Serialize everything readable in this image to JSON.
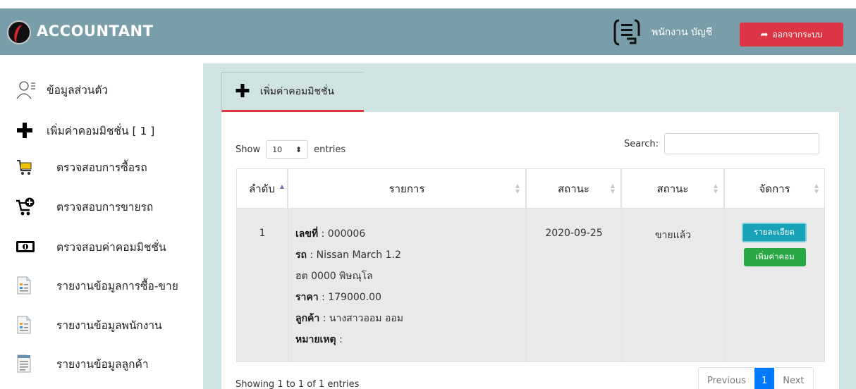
{
  "header": {
    "brand": "ACCOUNTANT",
    "user_label": "พนักงาน บัญชี",
    "logout_label": "ออกจากระบบ",
    "logout_icon": "sign-out-icon",
    "colors": {
      "navbar": "#7a9ea9",
      "logout": "#dc3545"
    }
  },
  "sidebar": {
    "items": [
      {
        "label": "ข้อมูลส่วนตัว",
        "icon": "user-profile-icon"
      },
      {
        "label": "เพิ่มค่าคอมมิชชั่น [ 1 ]",
        "icon": "plus-icon"
      },
      {
        "label": "ตรวจสอบการซื้อรถ",
        "icon": "cart-icon"
      },
      {
        "label": "ตรวจสอบการขายรถ",
        "icon": "cart-add-icon"
      },
      {
        "label": "ตรวจสอบค่าคอมมิชชั่น",
        "icon": "money-icon"
      },
      {
        "label": "รายงานข้อมูลการซื้อ-ขาย",
        "icon": "report-icon"
      },
      {
        "label": "รายงานข้อมูลพนักงาน",
        "icon": "report-icon"
      },
      {
        "label": "รายงานข้อมูลลูกค้า",
        "icon": "document-icon"
      }
    ]
  },
  "tab": {
    "label": "เพิ่มค่าคอมมิชชั่น"
  },
  "table_controls": {
    "show_label": "Show",
    "entries_value": "10",
    "entries_label": "entries",
    "search_label": "Search:"
  },
  "table": {
    "columns": [
      "ลำดับ",
      "รายการ",
      "สถานะ",
      "สถานะ",
      "จัดการ"
    ],
    "rows": [
      {
        "index": "1",
        "details": [
          {
            "key": "เลขที่",
            "value": " : 000006"
          },
          {
            "key": "รถ",
            "value": " : Nissan March 1.2"
          },
          {
            "key": "",
            "value": "ฮต 0000 พิษณุโล"
          },
          {
            "key": "ราคา",
            "value": " : 179000.00"
          },
          {
            "key": "ลูกค้า",
            "value": " : นางสาวออม ออม"
          },
          {
            "key": "หมายเหตุ",
            "value": " :"
          }
        ],
        "date": "2020-09-25",
        "status": "ขายแล้ว",
        "detail_button": "รายละเอียด",
        "add_button": "เพิ่มค่าคอม"
      }
    ]
  },
  "footer": {
    "info": "Showing 1 to 1 of 1 entries",
    "pagination": {
      "previous": "Previous",
      "current": "1",
      "next": "Next"
    }
  }
}
